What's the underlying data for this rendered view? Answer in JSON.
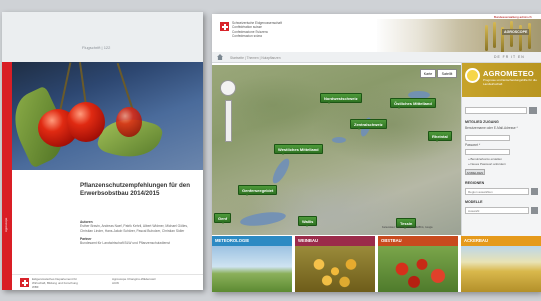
{
  "brochure": {
    "series": "Flugschrift | 122",
    "title": "Pflanzenschutzempfehlungen für den Erwerbsobstbau 2014/2015",
    "authors_heading": "Autoren",
    "authors": "Esther Bravin, Andreas Naef, Patrik Kehrli, Albert Widmer, Michael Gölles, Christian Linder, Hans-Jakob Schärer, Pascal Buholzer, Christian Sidler",
    "partner_heading": "Partner",
    "partner": "Bundesamt für Landwirtschaft BLW und Pflanzenschutzdienst",
    "side_label": "Agroscope",
    "footer_left": "Eidgenössisches Departement für Wirtschaft, Bildung und Forschung WBF",
    "footer_right": "Agroscope Changins-Wädenswil ACW"
  },
  "site": {
    "confederation": [
      "Schweizerische Eidgenossenschaft",
      "Confédération suisse",
      "Confederazione Svizzera",
      "Confederaziun svizra"
    ],
    "topline": "Bundesverwaltung admin.ch",
    "agroscope": "AGROSCOPE",
    "languages": "DE  FR  IT  EN",
    "breadcrumb": "Startseite  |  Themen  |  Nutzpflanzen",
    "map": {
      "map_button": "Karte",
      "satellite_button": "Satellit",
      "copyright": "Kartendaten ©2014 GeoBasis-DE/BKG, Google",
      "regions": [
        {
          "label": "Nordwestschweiz"
        },
        {
          "label": "Östliches Mittelland"
        },
        {
          "label": "Zentralschweiz"
        },
        {
          "label": "Westliches Mittelland"
        },
        {
          "label": "Rheintal"
        },
        {
          "label": "Genferseegebiet"
        },
        {
          "label": "Genf"
        },
        {
          "label": "Wallis"
        },
        {
          "label": "Tessin"
        }
      ]
    },
    "sidebar": {
      "agromet_title": "AGROMETEO",
      "agromet_sub": "Prognose und Entscheidungshilfe für die Landwirtschaft",
      "login_heading": "MITGLIED ZUGANG",
      "login_user_label": "Benutzername oder E-Mail-Adresse *",
      "password_label": "Passwort *",
      "create_account": "» Benutzerkonto erstellen",
      "new_password": "» Neues Passwort anfordern",
      "login_button": "ANMELDEN",
      "regions_heading": "REGIONEN",
      "region_placeholder": "Region auswählen",
      "models_heading": "MODELLE",
      "model_placeholder": "Auswahl"
    },
    "tiles": [
      "METEOROLOGIE",
      "WEINBAU",
      "OBSTBAU",
      "ACKERBAU"
    ]
  }
}
